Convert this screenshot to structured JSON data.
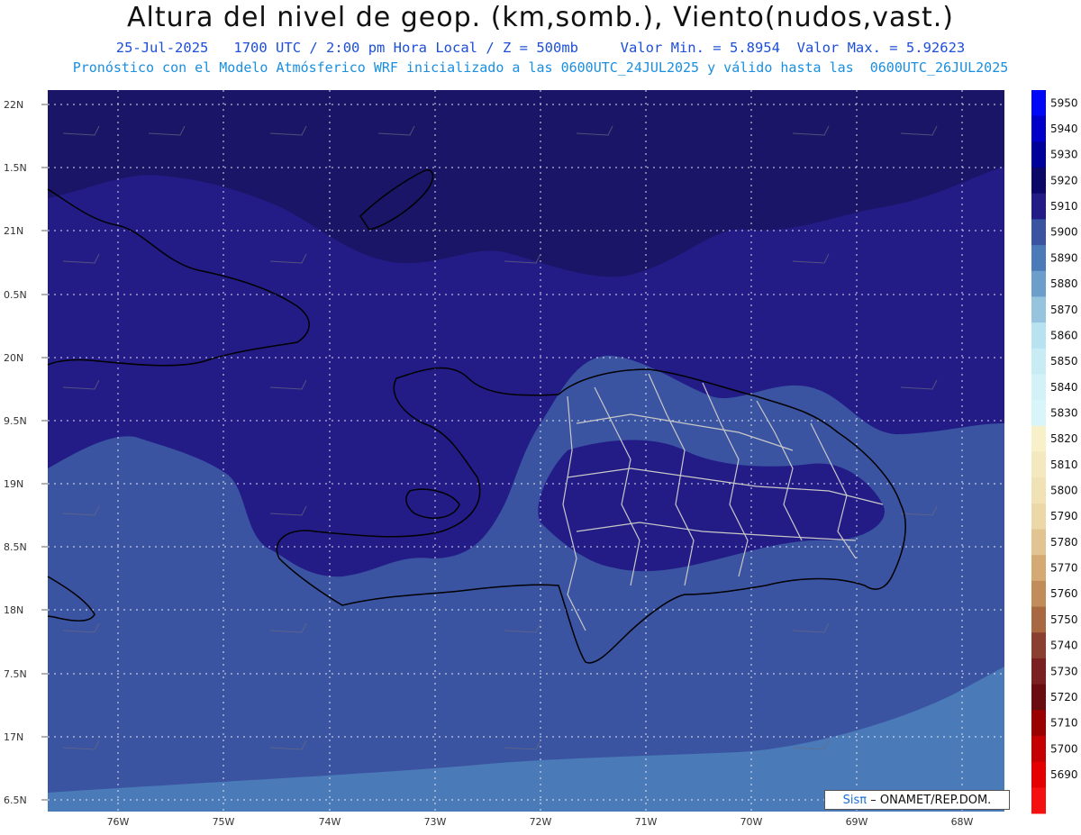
{
  "header": {
    "title": "Altura del nivel de geop. (km,somb.), Viento(nudos,vast.)",
    "line1": "25-Jul-2025   1700 UTC / 2:00 pm Hora Local / Z = 500mb     Valor Min. = 5.8954  Valor Max. = 5.92623",
    "line2": "Pronóstico con el Modelo Atmósferico WRF inicializado a las 0600UTC_24JUL2025 y válido hasta las  0600UTC_26JUL2025"
  },
  "map": {
    "lat_labels": [
      "22N",
      "1.5N",
      "21N",
      "0.5N",
      "20N",
      "9.5N",
      "19N",
      "8.5N",
      "18N",
      "7.5N",
      "17N",
      "6.5N"
    ],
    "lon_labels": [
      "76W",
      "75W",
      "74W",
      "73W",
      "72W",
      "71W",
      "70W",
      "69W",
      "68W"
    ]
  },
  "colorbar": {
    "levels": [
      "5950",
      "5940",
      "5930",
      "5920",
      "5910",
      "5900",
      "5890",
      "5880",
      "5870",
      "5860",
      "5850",
      "5840",
      "5830",
      "5820",
      "5810",
      "5800",
      "5790",
      "5780",
      "5770",
      "5760",
      "5750",
      "5740",
      "5730",
      "5720",
      "5710",
      "5700",
      "5690"
    ],
    "colors": [
      "#0008f5",
      "#0000c8",
      "#00009a",
      "#0c0868",
      "#231c86",
      "#3a54a2",
      "#4a7ab8",
      "#6c9ecc",
      "#96c4de",
      "#b8e2ef",
      "#c8ecf4",
      "#d2f2f8",
      "#d8f6fa",
      "#f8f0c8",
      "#f4e8be",
      "#f0e2b4",
      "#ecd8a6",
      "#e2c490",
      "#d4aa72",
      "#c08c58",
      "#a86840",
      "#8a4030",
      "#7a2020",
      "#6a0c10",
      "#9a0000",
      "#c40000",
      "#e40000",
      "#f41010"
    ]
  },
  "credit": {
    "brand": "Sisπ",
    "text": "– ONAMET/REP.DOM."
  },
  "colors": {
    "deep": "#1a1566",
    "dark": "#231c86",
    "mid": "#3a54a2",
    "light": "#4a7ab8",
    "coast": "#000000",
    "borders": "#c8c8c8"
  }
}
